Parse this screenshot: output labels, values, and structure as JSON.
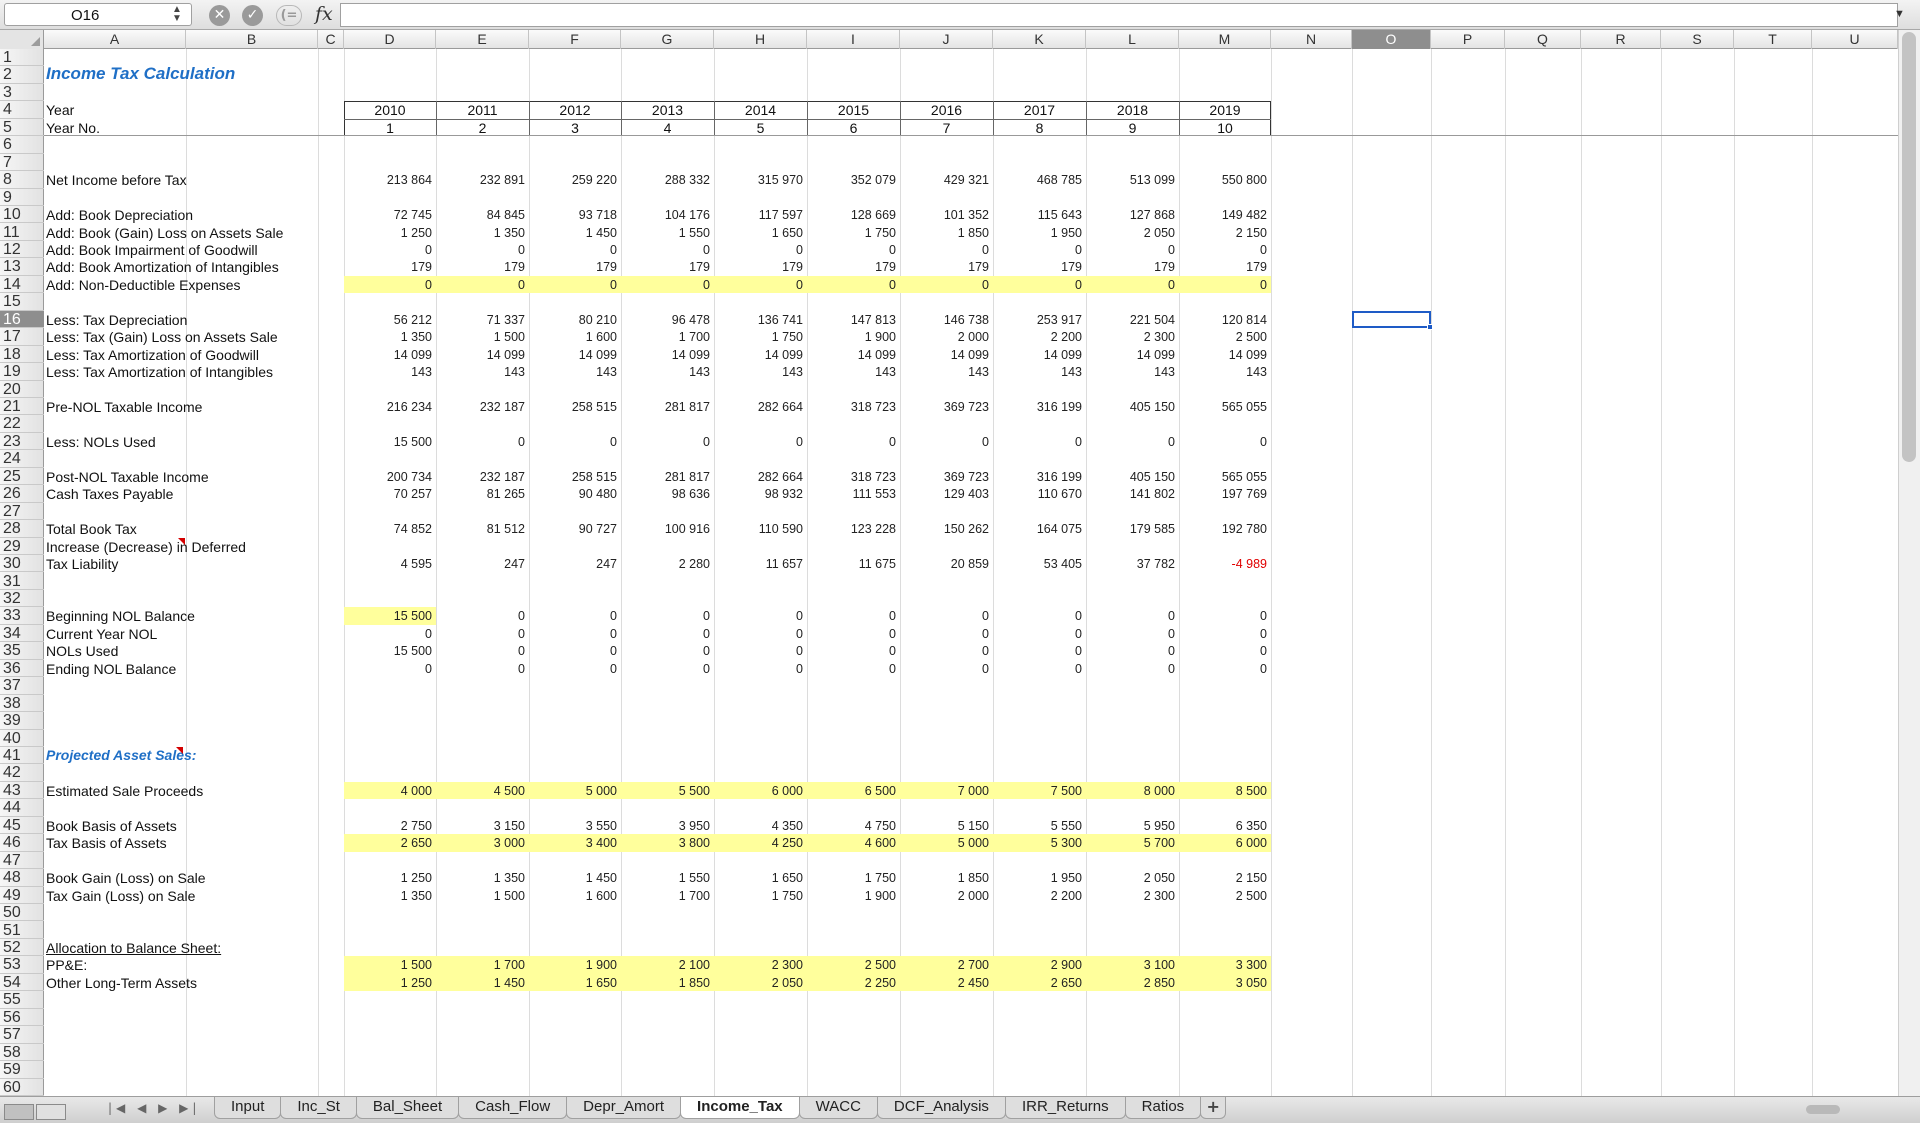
{
  "formula_bar": {
    "cell_ref": "O16",
    "formula": ""
  },
  "columns": [
    "A",
    "B",
    "C",
    "D",
    "E",
    "F",
    "G",
    "H",
    "I",
    "J",
    "K",
    "L",
    "M",
    "N",
    "O",
    "P",
    "Q",
    "R",
    "S",
    "T",
    "U"
  ],
  "selected_column": "O",
  "selected_row": 16,
  "row_count": 60,
  "sheet": {
    "title": "Income Tax Calculation",
    "year_label": "Year",
    "year_no_label": "Year No.",
    "years": [
      "2010",
      "2011",
      "2012",
      "2013",
      "2014",
      "2015",
      "2016",
      "2017",
      "2018",
      "2019"
    ],
    "year_nos": [
      "1",
      "2",
      "3",
      "4",
      "5",
      "6",
      "7",
      "8",
      "9",
      "10"
    ],
    "rows": [
      {
        "row": 8,
        "label": "Net Income before Tax",
        "values": [
          "213 864",
          "232 891",
          "259 220",
          "288 332",
          "315 970",
          "352 079",
          "429 321",
          "468 785",
          "513 099",
          "550 800"
        ]
      },
      {
        "row": 10,
        "label": "Add: Book Depreciation",
        "values": [
          "72 745",
          "84 845",
          "93 718",
          "104 176",
          "117 597",
          "128 669",
          "101 352",
          "115 643",
          "127 868",
          "149 482"
        ]
      },
      {
        "row": 11,
        "label": "Add: Book (Gain) Loss on Assets Sale",
        "values": [
          "1 250",
          "1 350",
          "1 450",
          "1 550",
          "1 650",
          "1 750",
          "1 850",
          "1 950",
          "2 050",
          "2 150"
        ]
      },
      {
        "row": 12,
        "label": "Add: Book Impairment of Goodwill",
        "values": [
          "0",
          "0",
          "0",
          "0",
          "0",
          "0",
          "0",
          "0",
          "0",
          "0"
        ]
      },
      {
        "row": 13,
        "label": "Add: Book Amortization of Intangibles",
        "values": [
          "179",
          "179",
          "179",
          "179",
          "179",
          "179",
          "179",
          "179",
          "179",
          "179"
        ]
      },
      {
        "row": 14,
        "label": "Add: Non-Deductible Expenses",
        "values": [
          "0",
          "0",
          "0",
          "0",
          "0",
          "0",
          "0",
          "0",
          "0",
          "0"
        ],
        "highlight": true
      },
      {
        "row": 16,
        "label": "Less: Tax Depreciation",
        "values": [
          "56 212",
          "71 337",
          "80 210",
          "96 478",
          "136 741",
          "147 813",
          "146 738",
          "253 917",
          "221 504",
          "120 814"
        ]
      },
      {
        "row": 17,
        "label": "Less: Tax (Gain) Loss on Assets Sale",
        "values": [
          "1 350",
          "1 500",
          "1 600",
          "1 700",
          "1 750",
          "1 900",
          "2 000",
          "2 200",
          "2 300",
          "2 500"
        ]
      },
      {
        "row": 18,
        "label": "Less: Tax Amortization of Goodwill",
        "values": [
          "14 099",
          "14 099",
          "14 099",
          "14 099",
          "14 099",
          "14 099",
          "14 099",
          "14 099",
          "14 099",
          "14 099"
        ]
      },
      {
        "row": 19,
        "label": "Less: Tax Amortization of Intangibles",
        "values": [
          "143",
          "143",
          "143",
          "143",
          "143",
          "143",
          "143",
          "143",
          "143",
          "143"
        ]
      },
      {
        "row": 21,
        "label": "Pre-NOL Taxable Income",
        "values": [
          "216 234",
          "232 187",
          "258 515",
          "281 817",
          "282 664",
          "318 723",
          "369 723",
          "316 199",
          "405 150",
          "565 055"
        ]
      },
      {
        "row": 23,
        "label": "Less: NOLs Used",
        "values": [
          "15 500",
          "0",
          "0",
          "0",
          "0",
          "0",
          "0",
          "0",
          "0",
          "0"
        ]
      },
      {
        "row": 25,
        "label": "Post-NOL Taxable Income",
        "values": [
          "200 734",
          "232 187",
          "258 515",
          "281 817",
          "282 664",
          "318 723",
          "369 723",
          "316 199",
          "405 150",
          "565 055"
        ]
      },
      {
        "row": 26,
        "label": "Cash Taxes Payable",
        "values": [
          "70 257",
          "81 265",
          "90 480",
          "98 636",
          "98 932",
          "111 553",
          "129 403",
          "110 670",
          "141 802",
          "197 769"
        ]
      },
      {
        "row": 28,
        "label": "Total Book Tax",
        "values": [
          "74 852",
          "81 512",
          "90 727",
          "100 916",
          "110 590",
          "123 228",
          "150 262",
          "164 075",
          "179 585",
          "192 780"
        ]
      },
      {
        "row": 29,
        "label": "Increase (Decrease) in Deferred",
        "values": []
      },
      {
        "row": 30,
        "label": "   Tax Liability",
        "values": [
          "4 595",
          "247",
          "247",
          "2 280",
          "11 657",
          "11 675",
          "20 859",
          "53 405",
          "37 782",
          "-4 989"
        ]
      },
      {
        "row": 33,
        "label": "Beginning NOL Balance",
        "values": [
          "15 500",
          "0",
          "0",
          "0",
          "0",
          "0",
          "0",
          "0",
          "0",
          "0"
        ],
        "highlight_first": true
      },
      {
        "row": 34,
        "label": "Current Year NOL",
        "values": [
          "0",
          "0",
          "0",
          "0",
          "0",
          "0",
          "0",
          "0",
          "0",
          "0"
        ]
      },
      {
        "row": 35,
        "label": "NOLs Used",
        "values": [
          "15 500",
          "0",
          "0",
          "0",
          "0",
          "0",
          "0",
          "0",
          "0",
          "0"
        ]
      },
      {
        "row": 36,
        "label": "Ending NOL Balance",
        "values": [
          "0",
          "0",
          "0",
          "0",
          "0",
          "0",
          "0",
          "0",
          "0",
          "0"
        ]
      },
      {
        "row": 43,
        "label": "Estimated Sale Proceeds",
        "values": [
          "4 000",
          "4 500",
          "5 000",
          "5 500",
          "6 000",
          "6 500",
          "7 000",
          "7 500",
          "8 000",
          "8 500"
        ],
        "highlight": true
      },
      {
        "row": 45,
        "label": "Book Basis of Assets",
        "values": [
          "2 750",
          "3 150",
          "3 550",
          "3 950",
          "4 350",
          "4 750",
          "5 150",
          "5 550",
          "5 950",
          "6 350"
        ]
      },
      {
        "row": 46,
        "label": "Tax Basis of Assets",
        "values": [
          "2 650",
          "3 000",
          "3 400",
          "3 800",
          "4 250",
          "4 600",
          "5 000",
          "5 300",
          "5 700",
          "6 000"
        ],
        "highlight": true
      },
      {
        "row": 48,
        "label": "Book Gain (Loss) on Sale",
        "values": [
          "1 250",
          "1 350",
          "1 450",
          "1 550",
          "1 650",
          "1 750",
          "1 850",
          "1 950",
          "2 050",
          "2 150"
        ]
      },
      {
        "row": 49,
        "label": "Tax Gain (Loss) on Sale",
        "values": [
          "1 350",
          "1 500",
          "1 600",
          "1 700",
          "1 750",
          "1 900",
          "2 000",
          "2 200",
          "2 300",
          "2 500"
        ]
      },
      {
        "row": 53,
        "label": "PP&E:",
        "values": [
          "1 500",
          "1 700",
          "1 900",
          "2 100",
          "2 300",
          "2 500",
          "2 700",
          "2 900",
          "3 100",
          "3 300"
        ],
        "highlight": true
      },
      {
        "row": 54,
        "label": "Other Long-Term Assets",
        "values": [
          "1 250",
          "1 450",
          "1 650",
          "1 850",
          "2 050",
          "2 250",
          "2 450",
          "2 650",
          "2 850",
          "3 050"
        ],
        "highlight": true
      }
    ],
    "projected_asset_sales_label": "Projected Asset Sales:",
    "allocation_label": "Allocation to Balance Sheet:"
  },
  "tabs": [
    {
      "label": "Input",
      "active": false
    },
    {
      "label": "Inc_St",
      "active": false
    },
    {
      "label": "Bal_Sheet",
      "active": false
    },
    {
      "label": "Cash_Flow",
      "active": false
    },
    {
      "label": "Depr_Amort",
      "active": false
    },
    {
      "label": "Income_Tax",
      "active": true
    },
    {
      "label": "WACC",
      "active": false
    },
    {
      "label": "DCF_Analysis",
      "active": false
    },
    {
      "label": "IRR_Returns",
      "active": false
    },
    {
      "label": "Ratios",
      "active": false
    }
  ],
  "add_sheet_label": "+",
  "colors": {
    "highlight": "#ffff9c",
    "title_blue": "#1f6fc6",
    "negative_red": "#e00000",
    "selection_blue": "#1e5bc6"
  }
}
